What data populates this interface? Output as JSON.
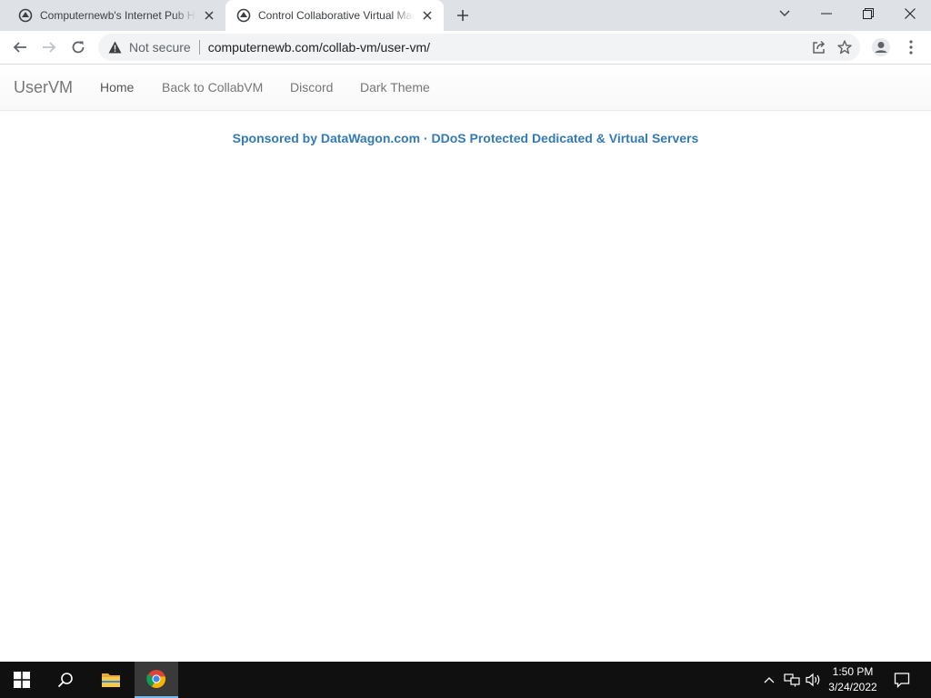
{
  "browser": {
    "tabs": [
      {
        "title": "Computernewb's Internet Pub Hub",
        "active": false,
        "favicon": "collabvm-favicon-icon"
      },
      {
        "title": "Control Collaborative Virtual Machines",
        "active": true,
        "favicon": "collabvm-favicon-icon"
      }
    ],
    "address_bar": {
      "security_label": "Not secure",
      "url": "computernewb.com/collab-vm/user-vm/"
    },
    "icons": {
      "back": "arrow-left-icon",
      "forward": "arrow-right-icon",
      "reload": "reload-icon",
      "share": "share-icon",
      "bookmark": "star-icon",
      "profile": "profile-icon",
      "menu": "kebab-menu-icon",
      "new_tab": "plus-icon",
      "tab_search": "chevron-down-icon",
      "minimize": "minimize-icon",
      "restore": "restore-icon",
      "close": "close-icon",
      "warning": "warning-triangle-icon"
    }
  },
  "page": {
    "brand": "UserVM",
    "nav": [
      {
        "label": "Home",
        "active": true
      },
      {
        "label": "Back to CollabVM",
        "active": false
      },
      {
        "label": "Discord",
        "active": false
      },
      {
        "label": "Dark Theme",
        "active": false
      }
    ],
    "sponsor_text": "Sponsored by DataWagon.com · DDoS Protected Dedicated & Virtual Servers",
    "colors": {
      "link": "#337ab7",
      "nav_text": "#777777"
    }
  },
  "taskbar": {
    "time": "1:50 PM",
    "date": "3/24/2022",
    "icons": [
      "windows-start-icon",
      "search-icon",
      "file-explorer-icon",
      "chrome-icon",
      "chevron-up-icon",
      "network-icon",
      "volume-icon",
      "notifications-icon"
    ]
  }
}
